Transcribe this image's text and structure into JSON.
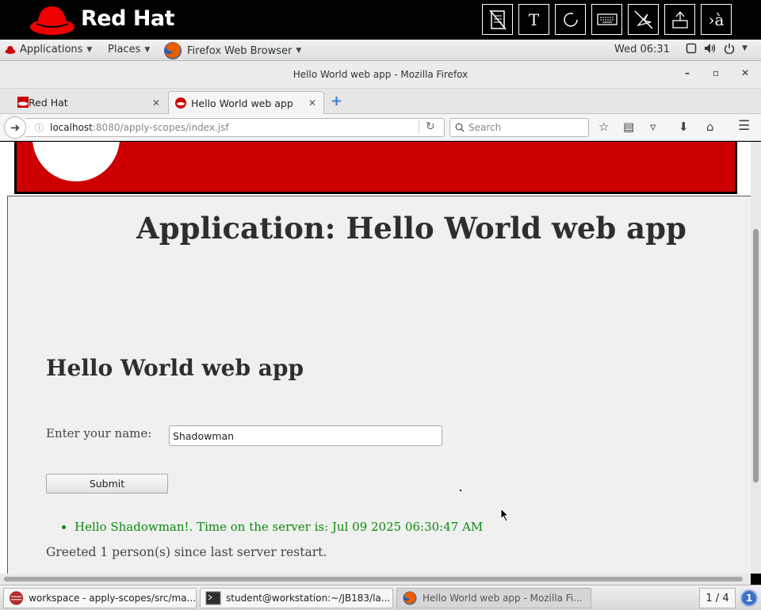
{
  "banner": {
    "logo_text": "Red Hat",
    "tools": [
      "T",
      "›à"
    ]
  },
  "panel": {
    "applications": "Applications",
    "places": "Places",
    "active_app": "Firefox Web Browser",
    "clock": "Wed 06:31"
  },
  "window": {
    "title": "Hello World web app - Mozilla Firefox"
  },
  "tabs": [
    {
      "label": "Red Hat"
    },
    {
      "label": "Hello World web app"
    }
  ],
  "navbar": {
    "url_host": "localhost",
    "url_path": ":8080/apply-scopes/index.jsf",
    "search_placeholder": "Search"
  },
  "page": {
    "app_heading": "Application: Hello World web app",
    "sub_heading": "Hello World web app",
    "name_label": "Enter your name:",
    "name_value": "Shadowman",
    "submit_label": "Submit",
    "greeting": "Hello Shadowman!. Time on the server is: Jul 09 2025 06:30:47 AM",
    "greet_count": "Greeted 1 person(s) since last server restart."
  },
  "taskbar": {
    "tasks": [
      "workspace - apply-scopes/src/ma...",
      "student@workstation:~/JB183/la...",
      "Hello World web app - Mozilla Fi..."
    ],
    "workspace": "1 / 4",
    "notifications": "1"
  },
  "colors": {
    "brand_red": "#cc0000",
    "greeting_green": "#0b8a0b"
  }
}
